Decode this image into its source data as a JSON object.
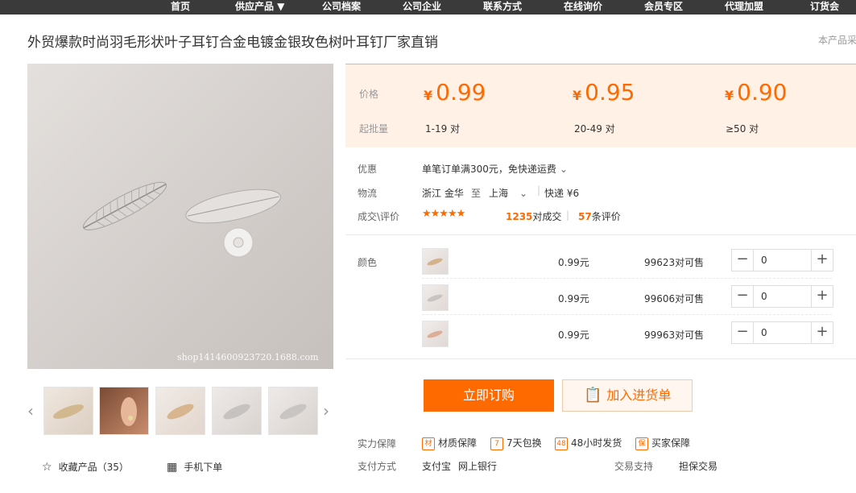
{
  "nav": [
    "首页",
    "供应产品 ▼",
    "公司档案",
    "公司企业",
    "联系方式",
    "在线询价",
    "会员专区",
    "代理加盟",
    "订货会"
  ],
  "title": "外贸爆款时尚羽毛形状叶子耳钉合金电镀金银玫色树叶耳钉厂家直销",
  "title_hint": "本产品采",
  "watermark": "shop1414600923720.1688.com",
  "price": {
    "label": "价格",
    "qty_label": "起批量",
    "currency": "¥",
    "tiers": [
      {
        "price": "0.99",
        "qty": "1-19 对"
      },
      {
        "price": "0.95",
        "qty": "20-49 对"
      },
      {
        "price": "0.90",
        "qty": "≥50 对"
      }
    ]
  },
  "info": {
    "discount_label": "优惠",
    "discount_text": "单笔订单满300元，免快递运费",
    "logistics_label": "物流",
    "origin": "浙江 金华",
    "to": "至",
    "dest": "上海",
    "express": "快递 ¥6",
    "rating_label": "成交\\评价",
    "stars": "★★★★★",
    "deals_count": "1235",
    "deals_text": "对成交",
    "reviews_count": "57",
    "reviews_text": "条评价"
  },
  "sku": {
    "label": "颜色",
    "rows": [
      {
        "price": "0.99元",
        "stock": "99623对可售",
        "qty": "0"
      },
      {
        "price": "0.99元",
        "stock": "99606对可售",
        "qty": "0"
      },
      {
        "price": "0.99元",
        "stock": "99963对可售",
        "qty": "0"
      }
    ]
  },
  "buttons": {
    "order": "立即订购",
    "cart": "加入进货单"
  },
  "guarantee": {
    "label": "实力保障",
    "items": [
      {
        "icon": "材",
        "text": "材质保障"
      },
      {
        "icon": "7",
        "text": "7天包换"
      },
      {
        "icon": "48",
        "text": "48小时发货"
      },
      {
        "icon": "保",
        "text": "买家保障"
      }
    ]
  },
  "payment": {
    "label": "支付方式",
    "methods": [
      "支付宝",
      "网上银行"
    ],
    "trade_label": "交易支持",
    "trade": "担保交易"
  },
  "favorites": {
    "text": "收藏产品",
    "count": "（35）"
  },
  "mobile_order": "手机下单",
  "colors": {
    "accent": "#ff6a00",
    "price_bg": "#fff1e6",
    "nav_bg": "#3a3a3a"
  }
}
